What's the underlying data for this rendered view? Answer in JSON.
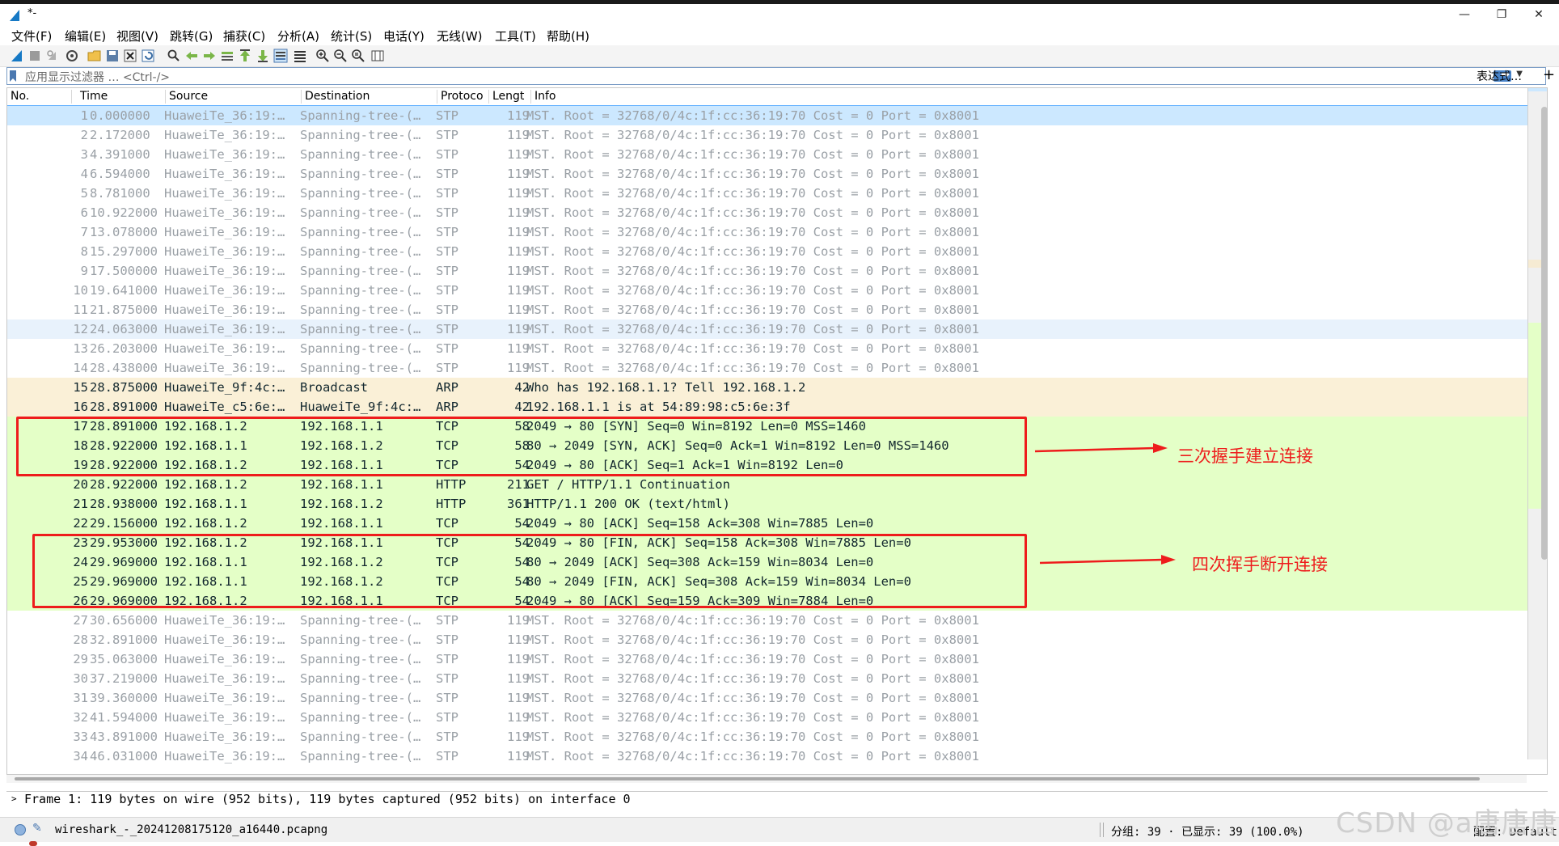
{
  "window": {
    "title": "*-",
    "minimize": "—",
    "restore": "❐",
    "close": "✕"
  },
  "menu": [
    "文件(F)",
    "编辑(E)",
    "视图(V)",
    "跳转(G)",
    "捕获(C)",
    "分析(A)",
    "统计(S)",
    "电话(Y)",
    "无线(W)",
    "工具(T)",
    "帮助(H)"
  ],
  "toolbar_icons": [
    "shark-fin-start-icon",
    "stop-icon",
    "restart-icon",
    "options-gear-icon",
    "open-folder-icon",
    "save-icon",
    "close-file-icon",
    "reload-icon",
    "find-icon",
    "go-back-icon",
    "go-forward-icon",
    "go-to-packet-icon",
    "first-packet-icon",
    "last-packet-icon",
    "autoscroll-icon",
    "colorize-icon",
    "zoom-in-icon",
    "zoom-out-icon",
    "zoom-normal-icon",
    "resize-columns-icon"
  ],
  "filter": {
    "placeholder": "应用显示过滤器 … <Ctrl-/>",
    "expression_label": "表达式…",
    "add_label": "+"
  },
  "columns": {
    "no": "No.",
    "time": "Time",
    "source": "Source",
    "destination": "Destination",
    "protocol": "Protoco",
    "length": "Lengt",
    "info": "Info"
  },
  "packets": [
    {
      "no": "1",
      "time": "0.000000",
      "src": "HuaweiTe_36:19:…",
      "dst": "Spanning-tree-(…",
      "proto": "STP",
      "len": "119",
      "info": "MST. Root = 32768/0/4c:1f:cc:36:19:70  Cost = 0  Port = 0x8001",
      "cls": "stp selected"
    },
    {
      "no": "2",
      "time": "2.172000",
      "src": "HuaweiTe_36:19:…",
      "dst": "Spanning-tree-(…",
      "proto": "STP",
      "len": "119",
      "info": "MST. Root = 32768/0/4c:1f:cc:36:19:70  Cost = 0  Port = 0x8001",
      "cls": "stp"
    },
    {
      "no": "3",
      "time": "4.391000",
      "src": "HuaweiTe_36:19:…",
      "dst": "Spanning-tree-(…",
      "proto": "STP",
      "len": "119",
      "info": "MST. Root = 32768/0/4c:1f:cc:36:19:70  Cost = 0  Port = 0x8001",
      "cls": "stp"
    },
    {
      "no": "4",
      "time": "6.594000",
      "src": "HuaweiTe_36:19:…",
      "dst": "Spanning-tree-(…",
      "proto": "STP",
      "len": "119",
      "info": "MST. Root = 32768/0/4c:1f:cc:36:19:70  Cost = 0  Port = 0x8001",
      "cls": "stp"
    },
    {
      "no": "5",
      "time": "8.781000",
      "src": "HuaweiTe_36:19:…",
      "dst": "Spanning-tree-(…",
      "proto": "STP",
      "len": "119",
      "info": "MST. Root = 32768/0/4c:1f:cc:36:19:70  Cost = 0  Port = 0x8001",
      "cls": "stp"
    },
    {
      "no": "6",
      "time": "10.922000",
      "src": "HuaweiTe_36:19:…",
      "dst": "Spanning-tree-(…",
      "proto": "STP",
      "len": "119",
      "info": "MST. Root = 32768/0/4c:1f:cc:36:19:70  Cost = 0  Port = 0x8001",
      "cls": "stp"
    },
    {
      "no": "7",
      "time": "13.078000",
      "src": "HuaweiTe_36:19:…",
      "dst": "Spanning-tree-(…",
      "proto": "STP",
      "len": "119",
      "info": "MST. Root = 32768/0/4c:1f:cc:36:19:70  Cost = 0  Port = 0x8001",
      "cls": "stp"
    },
    {
      "no": "8",
      "time": "15.297000",
      "src": "HuaweiTe_36:19:…",
      "dst": "Spanning-tree-(…",
      "proto": "STP",
      "len": "119",
      "info": "MST. Root = 32768/0/4c:1f:cc:36:19:70  Cost = 0  Port = 0x8001",
      "cls": "stp"
    },
    {
      "no": "9",
      "time": "17.500000",
      "src": "HuaweiTe_36:19:…",
      "dst": "Spanning-tree-(…",
      "proto": "STP",
      "len": "119",
      "info": "MST. Root = 32768/0/4c:1f:cc:36:19:70  Cost = 0  Port = 0x8001",
      "cls": "stp"
    },
    {
      "no": "10",
      "time": "19.641000",
      "src": "HuaweiTe_36:19:…",
      "dst": "Spanning-tree-(…",
      "proto": "STP",
      "len": "119",
      "info": "MST. Root = 32768/0/4c:1f:cc:36:19:70  Cost = 0  Port = 0x8001",
      "cls": "stp"
    },
    {
      "no": "11",
      "time": "21.875000",
      "src": "HuaweiTe_36:19:…",
      "dst": "Spanning-tree-(…",
      "proto": "STP",
      "len": "119",
      "info": "MST. Root = 32768/0/4c:1f:cc:36:19:70  Cost = 0  Port = 0x8001",
      "cls": "stp"
    },
    {
      "no": "12",
      "time": "24.063000",
      "src": "HuaweiTe_36:19:…",
      "dst": "Spanning-tree-(…",
      "proto": "STP",
      "len": "119",
      "info": "MST. Root = 32768/0/4c:1f:cc:36:19:70  Cost = 0  Port = 0x8001",
      "cls": "stp alt"
    },
    {
      "no": "13",
      "time": "26.203000",
      "src": "HuaweiTe_36:19:…",
      "dst": "Spanning-tree-(…",
      "proto": "STP",
      "len": "119",
      "info": "MST. Root = 32768/0/4c:1f:cc:36:19:70  Cost = 0  Port = 0x8001",
      "cls": "stp"
    },
    {
      "no": "14",
      "time": "28.438000",
      "src": "HuaweiTe_36:19:…",
      "dst": "Spanning-tree-(…",
      "proto": "STP",
      "len": "119",
      "info": "MST. Root = 32768/0/4c:1f:cc:36:19:70  Cost = 0  Port = 0x8001",
      "cls": "stp"
    },
    {
      "no": "15",
      "time": "28.875000",
      "src": "HuaweiTe_9f:4c:…",
      "dst": "Broadcast",
      "proto": "ARP",
      "len": "42",
      "info": "Who has 192.168.1.1? Tell 192.168.1.2",
      "cls": "arp"
    },
    {
      "no": "16",
      "time": "28.891000",
      "src": "HuaweiTe_c5:6e:…",
      "dst": "HuaweiTe_9f:4c:…",
      "proto": "ARP",
      "len": "42",
      "info": "192.168.1.1 is at 54:89:98:c5:6e:3f",
      "cls": "arp"
    },
    {
      "no": "17",
      "time": "28.891000",
      "src": "192.168.1.2",
      "dst": "192.168.1.1",
      "proto": "TCP",
      "len": "58",
      "info": "2049 → 80 [SYN] Seq=0 Win=8192 Len=0 MSS=1460",
      "cls": "tcp"
    },
    {
      "no": "18",
      "time": "28.922000",
      "src": "192.168.1.1",
      "dst": "192.168.1.2",
      "proto": "TCP",
      "len": "58",
      "info": "80 → 2049 [SYN, ACK] Seq=0 Ack=1 Win=8192 Len=0 MSS=1460",
      "cls": "tcp"
    },
    {
      "no": "19",
      "time": "28.922000",
      "src": "192.168.1.2",
      "dst": "192.168.1.1",
      "proto": "TCP",
      "len": "54",
      "info": "2049 → 80 [ACK] Seq=1 Ack=1 Win=8192 Len=0",
      "cls": "tcp"
    },
    {
      "no": "20",
      "time": "28.922000",
      "src": "192.168.1.2",
      "dst": "192.168.1.1",
      "proto": "HTTP",
      "len": "211",
      "info": "GET / HTTP/1.1 Continuation",
      "cls": "tcp"
    },
    {
      "no": "21",
      "time": "28.938000",
      "src": "192.168.1.1",
      "dst": "192.168.1.2",
      "proto": "HTTP",
      "len": "361",
      "info": "HTTP/1.1 200 OK  (text/html)",
      "cls": "tcp"
    },
    {
      "no": "22",
      "time": "29.156000",
      "src": "192.168.1.2",
      "dst": "192.168.1.1",
      "proto": "TCP",
      "len": "54",
      "info": "2049 → 80 [ACK] Seq=158 Ack=308 Win=7885 Len=0",
      "cls": "tcp"
    },
    {
      "no": "23",
      "time": "29.953000",
      "src": "192.168.1.2",
      "dst": "192.168.1.1",
      "proto": "TCP",
      "len": "54",
      "info": "2049 → 80 [FIN, ACK] Seq=158 Ack=308 Win=7885 Len=0",
      "cls": "tcp"
    },
    {
      "no": "24",
      "time": "29.969000",
      "src": "192.168.1.1",
      "dst": "192.168.1.2",
      "proto": "TCP",
      "len": "54",
      "info": "80 → 2049 [ACK] Seq=308 Ack=159 Win=8034 Len=0",
      "cls": "tcp"
    },
    {
      "no": "25",
      "time": "29.969000",
      "src": "192.168.1.1",
      "dst": "192.168.1.2",
      "proto": "TCP",
      "len": "54",
      "info": "80 → 2049 [FIN, ACK] Seq=308 Ack=159 Win=8034 Len=0",
      "cls": "tcp"
    },
    {
      "no": "26",
      "time": "29.969000",
      "src": "192.168.1.2",
      "dst": "192.168.1.1",
      "proto": "TCP",
      "len": "54",
      "info": "2049 → 80 [ACK] Seq=159 Ack=309 Win=7884 Len=0",
      "cls": "tcp"
    },
    {
      "no": "27",
      "time": "30.656000",
      "src": "HuaweiTe_36:19:…",
      "dst": "Spanning-tree-(…",
      "proto": "STP",
      "len": "119",
      "info": "MST. Root = 32768/0/4c:1f:cc:36:19:70  Cost = 0  Port = 0x8001",
      "cls": "stp"
    },
    {
      "no": "28",
      "time": "32.891000",
      "src": "HuaweiTe_36:19:…",
      "dst": "Spanning-tree-(…",
      "proto": "STP",
      "len": "119",
      "info": "MST. Root = 32768/0/4c:1f:cc:36:19:70  Cost = 0  Port = 0x8001",
      "cls": "stp"
    },
    {
      "no": "29",
      "time": "35.063000",
      "src": "HuaweiTe_36:19:…",
      "dst": "Spanning-tree-(…",
      "proto": "STP",
      "len": "119",
      "info": "MST. Root = 32768/0/4c:1f:cc:36:19:70  Cost = 0  Port = 0x8001",
      "cls": "stp"
    },
    {
      "no": "30",
      "time": "37.219000",
      "src": "HuaweiTe_36:19:…",
      "dst": "Spanning-tree-(…",
      "proto": "STP",
      "len": "119",
      "info": "MST. Root = 32768/0/4c:1f:cc:36:19:70  Cost = 0  Port = 0x8001",
      "cls": "stp"
    },
    {
      "no": "31",
      "time": "39.360000",
      "src": "HuaweiTe_36:19:…",
      "dst": "Spanning-tree-(…",
      "proto": "STP",
      "len": "119",
      "info": "MST. Root = 32768/0/4c:1f:cc:36:19:70  Cost = 0  Port = 0x8001",
      "cls": "stp"
    },
    {
      "no": "32",
      "time": "41.594000",
      "src": "HuaweiTe_36:19:…",
      "dst": "Spanning-tree-(…",
      "proto": "STP",
      "len": "119",
      "info": "MST. Root = 32768/0/4c:1f:cc:36:19:70  Cost = 0  Port = 0x8001",
      "cls": "stp"
    },
    {
      "no": "33",
      "time": "43.891000",
      "src": "HuaweiTe_36:19:…",
      "dst": "Spanning-tree-(…",
      "proto": "STP",
      "len": "119",
      "info": "MST. Root = 32768/0/4c:1f:cc:36:19:70  Cost = 0  Port = 0x8001",
      "cls": "stp"
    },
    {
      "no": "34",
      "time": "46.031000",
      "src": "HuaweiTe_36:19:…",
      "dst": "Spanning-tree-(…",
      "proto": "STP",
      "len": "119",
      "info": "MST. Root = 32768/0/4c:1f:cc:36:19:70  Cost = 0  Port = 0x8001",
      "cls": "stp"
    }
  ],
  "details": {
    "line": "Frame 1: 119 bytes on wire (952 bits), 119 bytes captured (952 bits) on interface 0",
    "expander": ">"
  },
  "annotations": {
    "handshake": "三次握手建立连接",
    "teardown": "四次挥手断开连接"
  },
  "status": {
    "file": "wireshark_-_20241208175120_a16440.pcapng",
    "stats": "分组: 39 · 已显示: 39 (100.0%)",
    "profile": "配置: Default"
  },
  "watermark": "CSDN @a唐唐唐",
  "colors": {
    "stp_fg": "#9aa0a6",
    "arp_bg": "#faf0d7",
    "tcp_bg": "#e4ffc7",
    "selected_bg": "#cce8ff",
    "annotation_red": "#ee1c1c"
  }
}
